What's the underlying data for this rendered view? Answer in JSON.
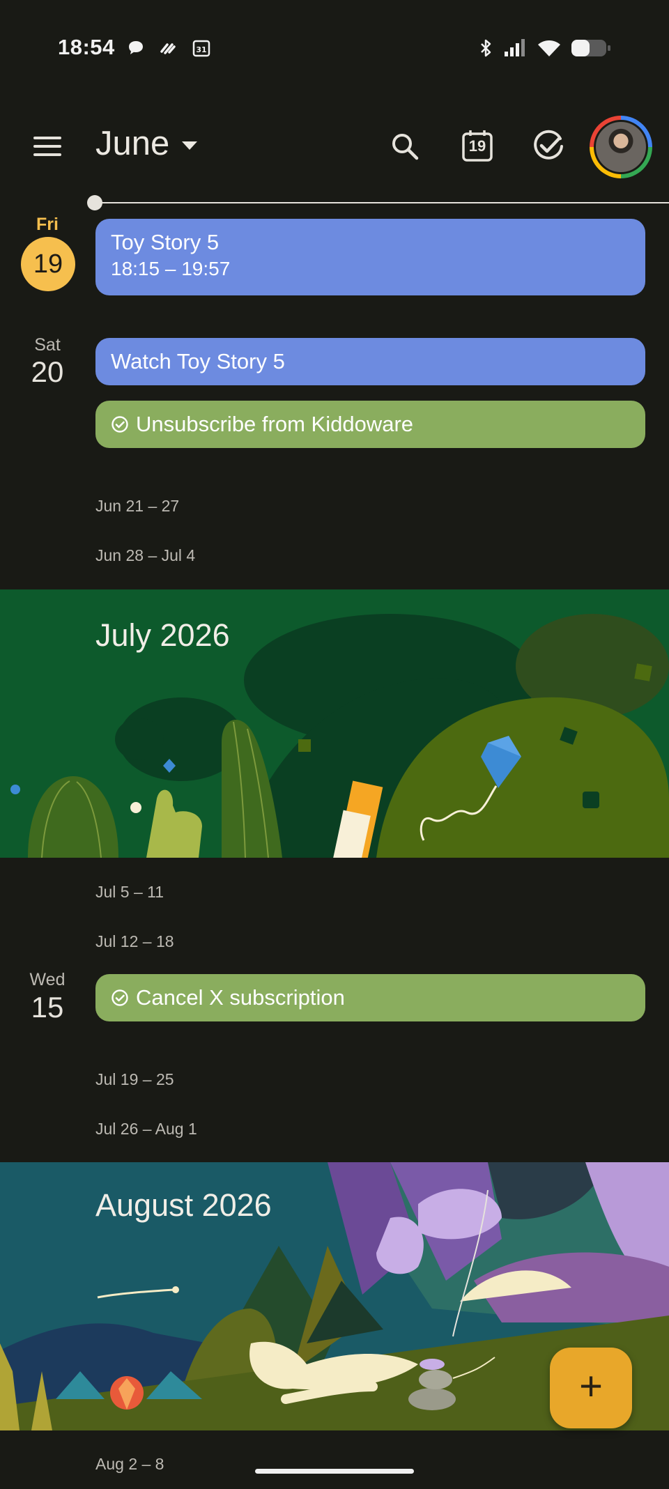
{
  "status_bar": {
    "time": "18:54",
    "icons": [
      "chat-bubble-icon",
      "sports-icon",
      "calendar-31-icon",
      "bluetooth-icon",
      "signal-icon",
      "wifi-icon",
      "battery-icon"
    ]
  },
  "header": {
    "month": "June",
    "today_icon_number": "19",
    "icons": [
      "menu-icon",
      "search-icon",
      "today-icon",
      "tasks-check-icon",
      "avatar"
    ]
  },
  "days": [
    {
      "dow": "Fri",
      "day": "19",
      "is_today": true,
      "events": [
        {
          "title": "Toy Story 5",
          "time": "18:15 – 19:57",
          "color": "#6d8be0"
        }
      ]
    },
    {
      "dow": "Sat",
      "day": "20",
      "events": [
        {
          "title": "Watch Toy Story 5",
          "color": "#6d8be0"
        },
        {
          "title": "Unsubscribe from Kiddoware",
          "type": "task",
          "color": "#8aad5e"
        }
      ]
    },
    {
      "dow": "Wed",
      "day": "15",
      "events": [
        {
          "title": "Cancel X subscription",
          "type": "task",
          "color": "#8aad5e"
        }
      ]
    }
  ],
  "week_ranges": [
    "Jun 21 – 27",
    "Jun 28 – Jul 4",
    "Jul 5 – 11",
    "Jul 12 – 18",
    "Jul 19 – 25",
    "Jul 26 – Aug 1",
    "Aug 2 – 8"
  ],
  "banners": {
    "july": "July 2026",
    "august": "August 2026"
  },
  "fab": {
    "label": "+",
    "color": "#e8a72a"
  },
  "colors": {
    "background": "#191a15",
    "today": "#f6bf4e",
    "event_blue": "#6d8be0",
    "task_green": "#8aad5e"
  }
}
